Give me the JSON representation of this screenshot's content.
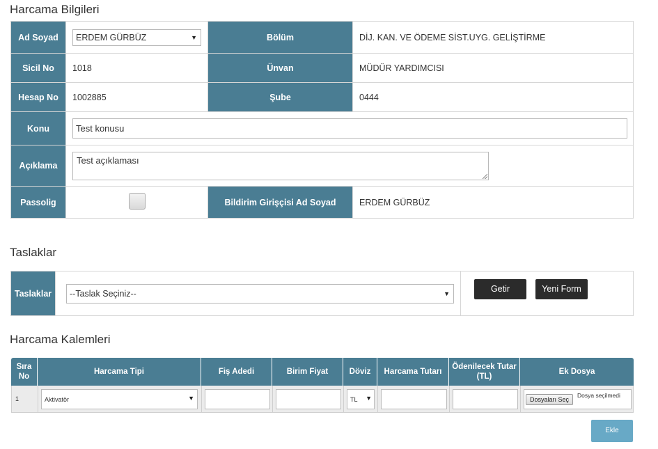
{
  "section1": {
    "title": "Harcama Bilgileri",
    "ad_soyad_label": "Ad Soyad",
    "ad_soyad_value": "ERDEM GÜRBÜZ",
    "bolum_label": "Bölüm",
    "bolum_value": "DİJ. KAN. VE ÖDEME SİST.UYG. GELİŞTİRME",
    "sicil_label": "Sicil No",
    "sicil_value": "1018",
    "unvan_label": "Ünvan",
    "unvan_value": "MÜDÜR YARDIMCISI",
    "hesap_label": "Hesap No",
    "hesap_value": "1002885",
    "sube_label": "Şube",
    "sube_value": "0444",
    "konu_label": "Konu",
    "konu_value": "Test konusu",
    "aciklama_label": "Açıklama",
    "aciklama_value": "Test açıklaması",
    "passolig_label": "Passolig",
    "passolig_checked": false,
    "bildirim_label": "Bildirim Girişçisi Ad Soyad",
    "bildirim_value": "ERDEM GÜRBÜZ"
  },
  "section2": {
    "title": "Taslaklar",
    "label": "Taslaklar",
    "select_value": "--Taslak Seçiniz--",
    "getir_label": "Getir",
    "yeni_form_label": "Yeni Form"
  },
  "section3": {
    "title": "Harcama Kalemleri",
    "columns": {
      "sira_no": "Sıra No",
      "harcama_tipi": "Harcama Tipi",
      "fis_adedi": "Fiş Adedi",
      "birim_fiyat": "Birim Fiyat",
      "doviz": "Döviz",
      "harcama_tutari": "Harcama Tutarı",
      "odenecek_tutar": "Ödenilecek Tutar (TL)",
      "ek_dosya": "Ek Dosya"
    },
    "rows": [
      {
        "sira_no": "1",
        "harcama_tipi": "Aktivatör",
        "fis_adedi": "",
        "birim_fiyat": "",
        "doviz": "TL",
        "harcama_tutari": "",
        "odenecek_tutar": "",
        "file_button": "Dosyaları Seç",
        "file_status": "Dosya seçilmedi"
      }
    ],
    "ekle_label": "Ekle"
  },
  "colors": {
    "header_bg": "#4a7d93",
    "dark_button": "#2b2b2b",
    "ekle_button": "#68a9c6"
  },
  "icons": [
    "chevron-down-icon",
    "resize-grip-icon"
  ]
}
